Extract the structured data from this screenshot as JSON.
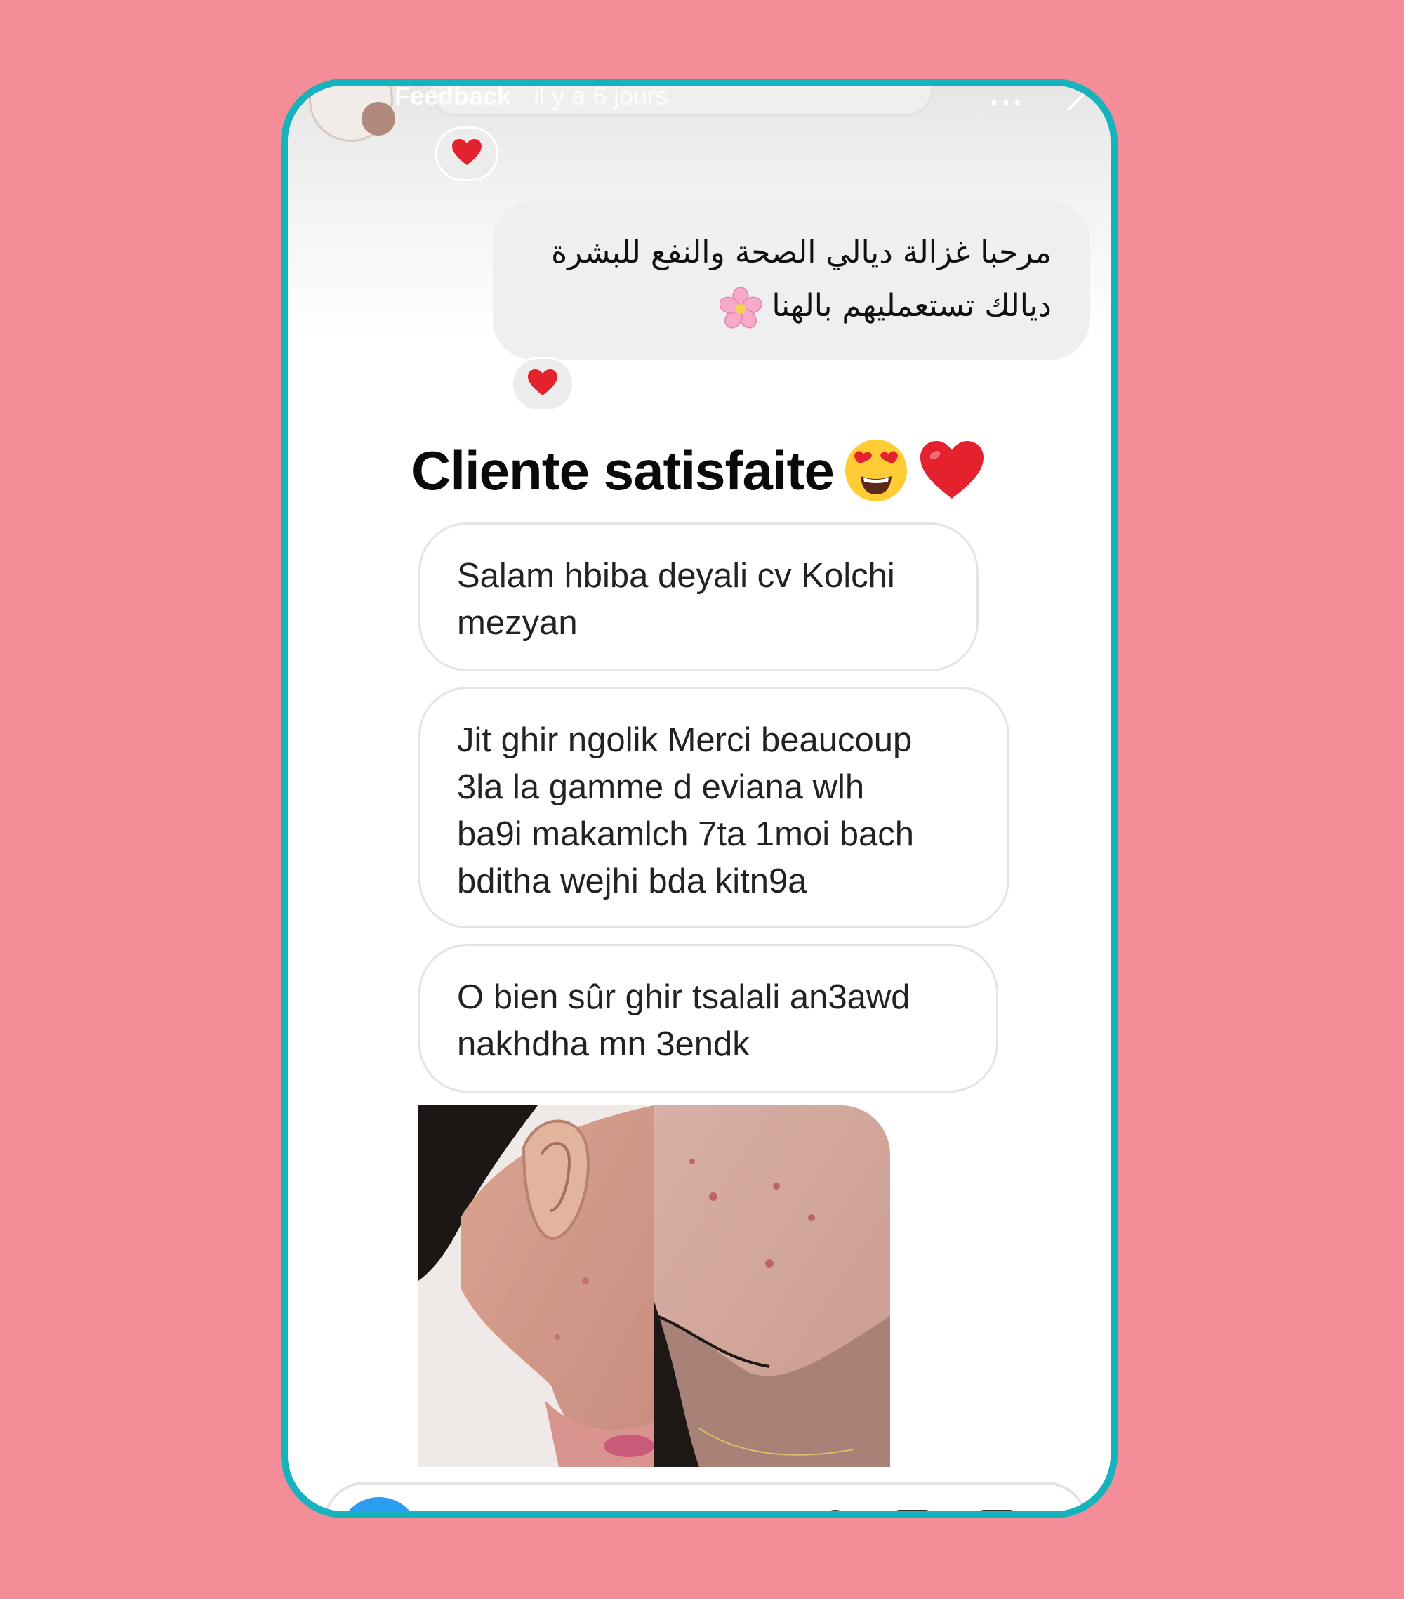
{
  "story": {
    "name": "Feedback",
    "time": "il y a 6 jours",
    "more_icon": "more-horizontal-icon",
    "close_icon": "close-icon"
  },
  "arabic_message": {
    "line1": "مرحبا غزالة ديالي الصحة والنفع للبشرة",
    "line2": "ديالك تستعمليهم بالهنا",
    "emoji": "cherry-blossom-icon"
  },
  "headline": {
    "text": "Cliente satisfaite",
    "emojis": [
      "heart-eyes-emoji-icon",
      "red-heart-icon"
    ]
  },
  "messages": [
    {
      "lines": [
        "Salam hbiba deyali cv Kolchi",
        "mezyan"
      ]
    },
    {
      "lines": [
        "Jit ghir ngolik Merci beaucoup",
        "3la la gamme d eviana wlh",
        "ba9i makamlch 7ta 1moi bach",
        "bditha wejhi bda kitn9a"
      ]
    },
    {
      "lines": [
        "O bien sûr ghir tsalali an3awd",
        "nakhdha mn 3endk"
      ]
    }
  ],
  "colors": {
    "background": "#f48d97",
    "frame_border": "#16b3bd",
    "bubble_gray": "#efefef",
    "heart_red": "#e3222d",
    "camera_blue": "#2c9cf2"
  }
}
